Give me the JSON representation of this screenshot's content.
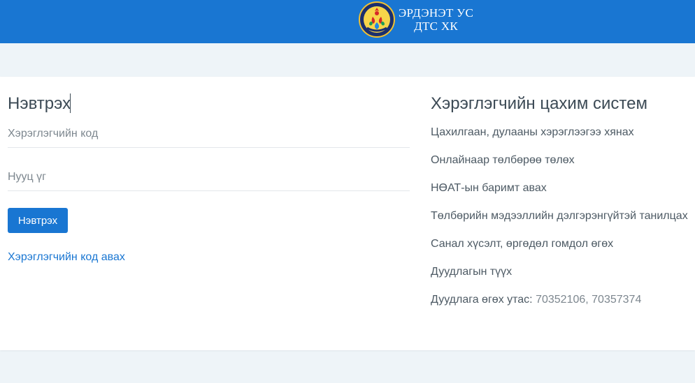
{
  "header": {
    "company_line1": "ЭРДЭНЭТ УС",
    "company_line2": "ДТС ХК",
    "logo_icon": "company-emblem-icon",
    "background_color": "#1976d2"
  },
  "login": {
    "title": "Нэвтрэх",
    "username_placeholder": "Хэрэглэгчийн код",
    "password_placeholder": "Нууц үг",
    "submit_label": "Нэвтрэх",
    "register_link": "Хэрэглэгчийн код авах"
  },
  "info": {
    "title": "Хэрэглэгчийн цахим систем",
    "items": [
      "Цахилгаан, дулааны хэрэглээгээ хянах",
      "Онлайнаар төлбөрөө төлөх",
      "НӨАТ-ын баримт авах",
      "Төлбөрийн мэдээллийн дэлгэрэнгүйтэй танилцах",
      "Санал хүсэлт, өргөдөл гомдол өгөх",
      "Дуудлагын түүх"
    ],
    "phone_label": "Дуудлага өгөх утас: ",
    "phone_numbers": "70352106, 70357374"
  },
  "colors": {
    "accent": "#1976d2",
    "page_background": "#eef4f8"
  }
}
